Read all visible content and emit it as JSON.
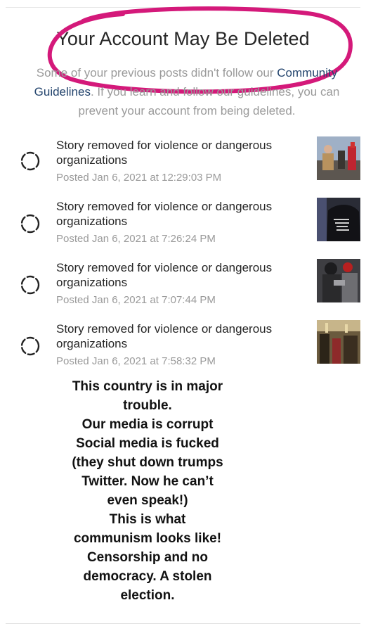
{
  "header": {
    "title": "Your Account May Be Deleted",
    "subtitle_pre": "Some of your previous posts didn't follow our ",
    "subtitle_link": "Community Guidelines",
    "subtitle_post": ". If you learn and follow our guidelines, you can prevent your account from being deleted."
  },
  "items": [
    {
      "title": "Story removed for violence or dangerous organizations",
      "date": "Posted Jan 6, 2021 at 12:29:03 PM",
      "icon": "loading-spinner-icon"
    },
    {
      "title": "Story removed for violence or dangerous organizations",
      "date": "Posted Jan 6, 2021 at 7:26:24 PM",
      "icon": "loading-spinner-icon"
    },
    {
      "title": "Story removed for violence or dangerous organizations",
      "date": "Posted Jan 6, 2021 at 7:07:44 PM",
      "icon": "loading-spinner-icon"
    },
    {
      "title": "Story removed for violence or dangerous organizations",
      "date": "Posted Jan 6, 2021 at 7:58:32 PM",
      "icon": "loading-spinner-icon"
    }
  ],
  "caption": [
    "This country is in major",
    "trouble.",
    "Our media is corrupt",
    "Social media is fucked",
    "(they shut down trumps",
    "Twitter. Now he can’t",
    "even speak!)",
    "This is what",
    "communism looks like!",
    "Censorship and no",
    "democracy. A stolen",
    "election."
  ],
  "colors": {
    "annotation": "#d4197a",
    "link": "#23446d",
    "muted_text": "#9a9a9a"
  }
}
